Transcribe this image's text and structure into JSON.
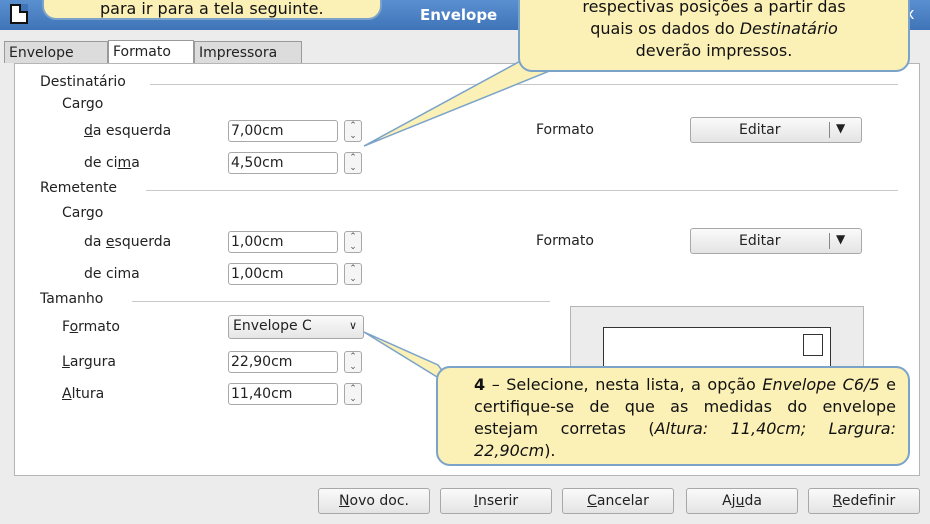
{
  "window": {
    "title": "Envelope",
    "close": "x"
  },
  "tabs": [
    "Envelope",
    "Formato",
    "Impressora"
  ],
  "destinatario": {
    "section": "Destinatário",
    "cargo": "Cargo",
    "esquerda_label": "da esquerda",
    "esquerda_value": "7,00cm",
    "cima_label": "de cima",
    "cima_value": "4,50cm",
    "formato_label": "Formato",
    "editar": "Editar"
  },
  "remetente": {
    "section": "Remetente",
    "cargo": "Cargo",
    "esquerda_label": "da esquerda",
    "esquerda_value": "1,00cm",
    "cima_label": "de cima",
    "cima_value": "1,00cm",
    "formato_label": "Formato",
    "editar": "Editar"
  },
  "tamanho": {
    "section": "Tamanho",
    "formato_label": "Formato",
    "formato_value": "Envelope C",
    "largura_label": "Largura",
    "largura_value": "22,90cm",
    "altura_label": "Altura",
    "altura_value": "11,40cm"
  },
  "buttons": {
    "novo": "Novo doc.",
    "inserir": "Inserir",
    "cancelar": "Cancelar",
    "ajuda": "Ajuda",
    "redefinir": "Redefinir"
  },
  "callouts": {
    "top_left": "para ir para a tela seguinte.",
    "top_right_line1": "respectivas posições a partir das",
    "top_right_line2": "quais os dados do Destinatário",
    "top_right_line3": "deverão impressos.",
    "note4_num": "4",
    "note4_text": "– Selecione, nesta lista, a opção Envelope C6/5 e certifique-se de que as medidas do envelope estejam corretas (Altura: 11,40cm; Largura: 22,90cm)."
  }
}
